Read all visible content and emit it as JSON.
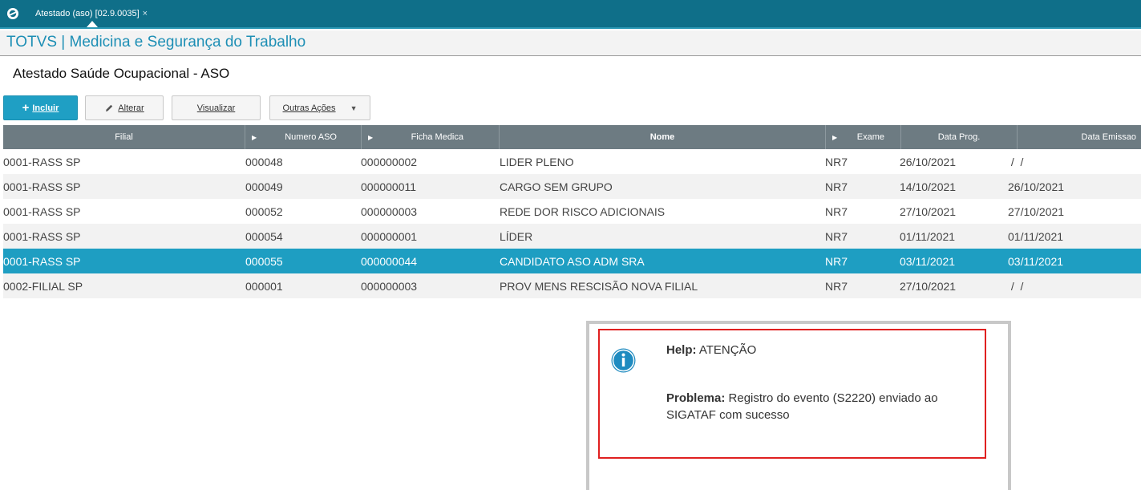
{
  "window": {
    "tab_title": "Atestado (aso) [02.9.0035]",
    "tab_close": "×"
  },
  "module_title": "TOTVS | Medicina e Segurança do Trabalho",
  "page_title": "Atestado Saúde Ocupacional - ASO",
  "toolbar": {
    "incluir_icon": "+",
    "incluir_label": "Incluir",
    "alterar_label": "Alterar",
    "visualizar_label": "Visualizar",
    "outras_acoes_label": "Outras Ações"
  },
  "grid": {
    "columns": [
      "Filial",
      "Numero ASO",
      "Ficha Medica",
      "Nome",
      "Exame",
      "Data Prog.",
      "Data Emissao"
    ],
    "rows": [
      [
        "0001-RASS SP",
        "000048",
        "000000002",
        "LIDER PLENO",
        "NR7",
        "26/10/2021",
        " /  /"
      ],
      [
        "0001-RASS SP",
        "000049",
        "000000011",
        "CARGO SEM GRUPO",
        "NR7",
        "14/10/2021",
        "26/10/2021"
      ],
      [
        "0001-RASS SP",
        "000052",
        "000000003",
        "REDE DOR RISCO ADICIONAIS",
        "NR7",
        "27/10/2021",
        "27/10/2021"
      ],
      [
        "0001-RASS SP",
        "000054",
        "000000001",
        "LÍDER",
        "NR7",
        "01/11/2021",
        "01/11/2021"
      ],
      [
        "0001-RASS SP",
        "000055",
        "000000044",
        "CANDIDATO ASO ADM SRA",
        "NR7",
        "03/11/2021",
        "03/11/2021"
      ],
      [
        "0002-FILIAL SP",
        "000001",
        "000000003",
        "PROV MENS RESCISÃO NOVA FILIAL",
        "NR7",
        "27/10/2021",
        " /  /"
      ]
    ],
    "selected_row_index": 4
  },
  "dialog": {
    "help_label": "Help:",
    "help_text": "ATENÇÃO",
    "problem_label": "Problema:",
    "problem_text": "Registro do evento (S2220) enviado ao SIGATAF com sucesso",
    "icon": "info-icon"
  },
  "colors": {
    "topbar": "#0f6f89",
    "accent": "#1e9ec2",
    "header": "#6d7b82",
    "highlight_border": "#e02020"
  }
}
